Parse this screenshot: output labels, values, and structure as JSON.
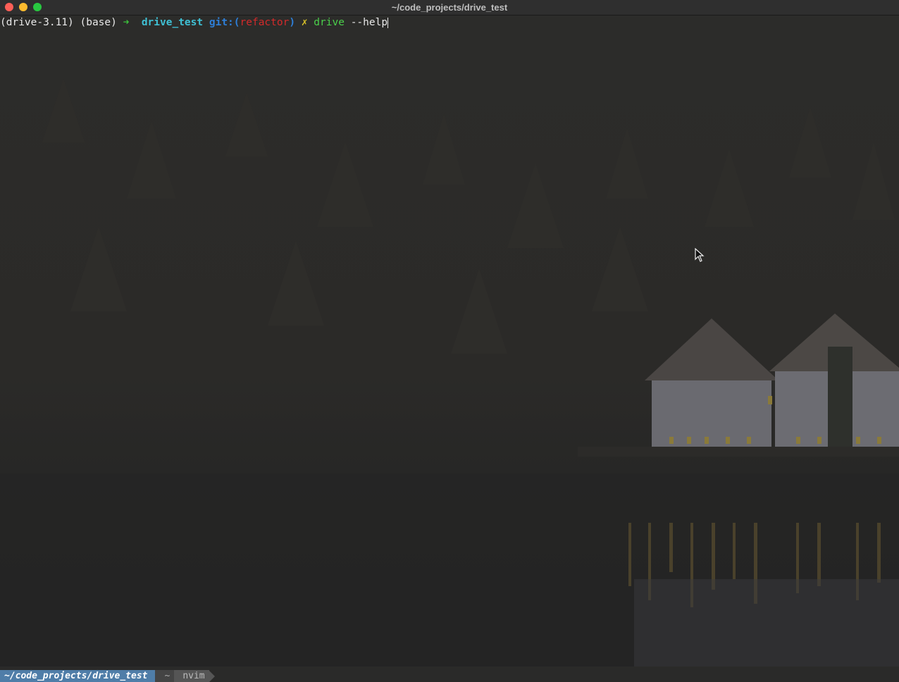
{
  "window": {
    "title": "~/code_projects/drive_test",
    "controls": [
      "close",
      "minimize",
      "maximize"
    ]
  },
  "prompt": {
    "env": "(drive-3.11) (base)",
    "arrow": "➜",
    "directory": "drive_test",
    "git_label": "git:(",
    "branch": "refactor",
    "git_close": ")",
    "dirty_marker": "✗",
    "command": "drive",
    "args": "--help"
  },
  "statusbar": {
    "path": "~/code_projects/drive_test",
    "home": "~",
    "process": "nvim"
  },
  "colors": {
    "path_segment": "#4f7da8",
    "branch": "#d42a2a",
    "directory": "#3fc0d4",
    "command": "#4bd04b"
  }
}
